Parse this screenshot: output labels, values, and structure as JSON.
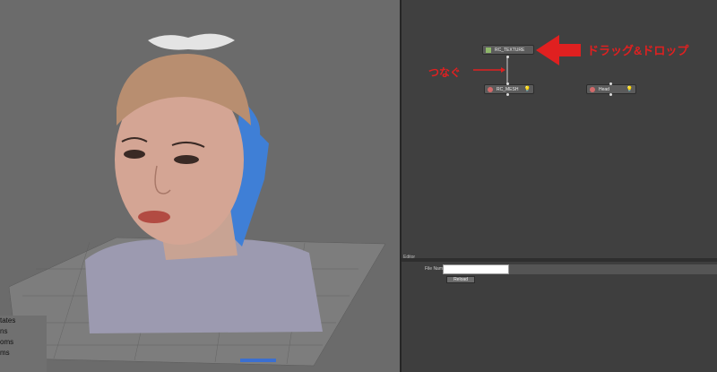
{
  "viewport": {
    "side_menu": [
      "tates",
      "ns",
      "oms",
      "ms"
    ]
  },
  "nodes": {
    "texture": "RC_TEXTURE",
    "mesh": "RC_MESH",
    "head": "Head"
  },
  "annotations": {
    "drag_drop": "ドラッグ&ドロップ",
    "connect": "つなぐ"
  },
  "editor": {
    "header_label": "Editor",
    "file_name_label": "File Name",
    "file_name_value": "",
    "reload_label": "Reload"
  },
  "colors": {
    "annotation_red": "#e02020",
    "viewport_bg": "#6b6b6b",
    "graph_bg": "#404040"
  }
}
